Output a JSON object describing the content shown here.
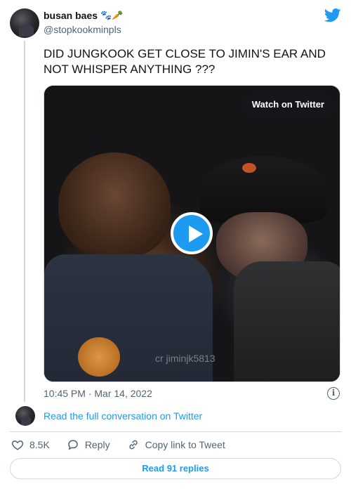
{
  "tweet": {
    "author_name": "busan baes",
    "author_emojis": "🐾🥕",
    "handle": "@stopkookminpls",
    "text": "DID JUNGKOOK GET CLOSE TO JIMIN'S EAR AND NOT WHISPER ANYTHING ???",
    "timestamp": "10:45 PM · Mar 14, 2022",
    "media": {
      "watch_label": "Watch on Twitter",
      "watermark": "cr jiminjk5813"
    }
  },
  "conversation": {
    "read_full_label": "Read the full conversation on Twitter"
  },
  "actions": {
    "like_count": "8.5K",
    "reply_label": "Reply",
    "copy_label": "Copy link to Tweet"
  },
  "footer": {
    "read_replies_label": "Read 91 replies"
  },
  "icons": {
    "twitter": "twitter-bird-icon",
    "info": "info-icon",
    "like": "heart-icon",
    "reply": "speech-bubble-icon",
    "copy": "link-icon",
    "play": "play-icon"
  },
  "colors": {
    "accent": "#1d9bf0",
    "text": "#0f1419",
    "secondary": "#536471",
    "border": "#cfd9de"
  }
}
